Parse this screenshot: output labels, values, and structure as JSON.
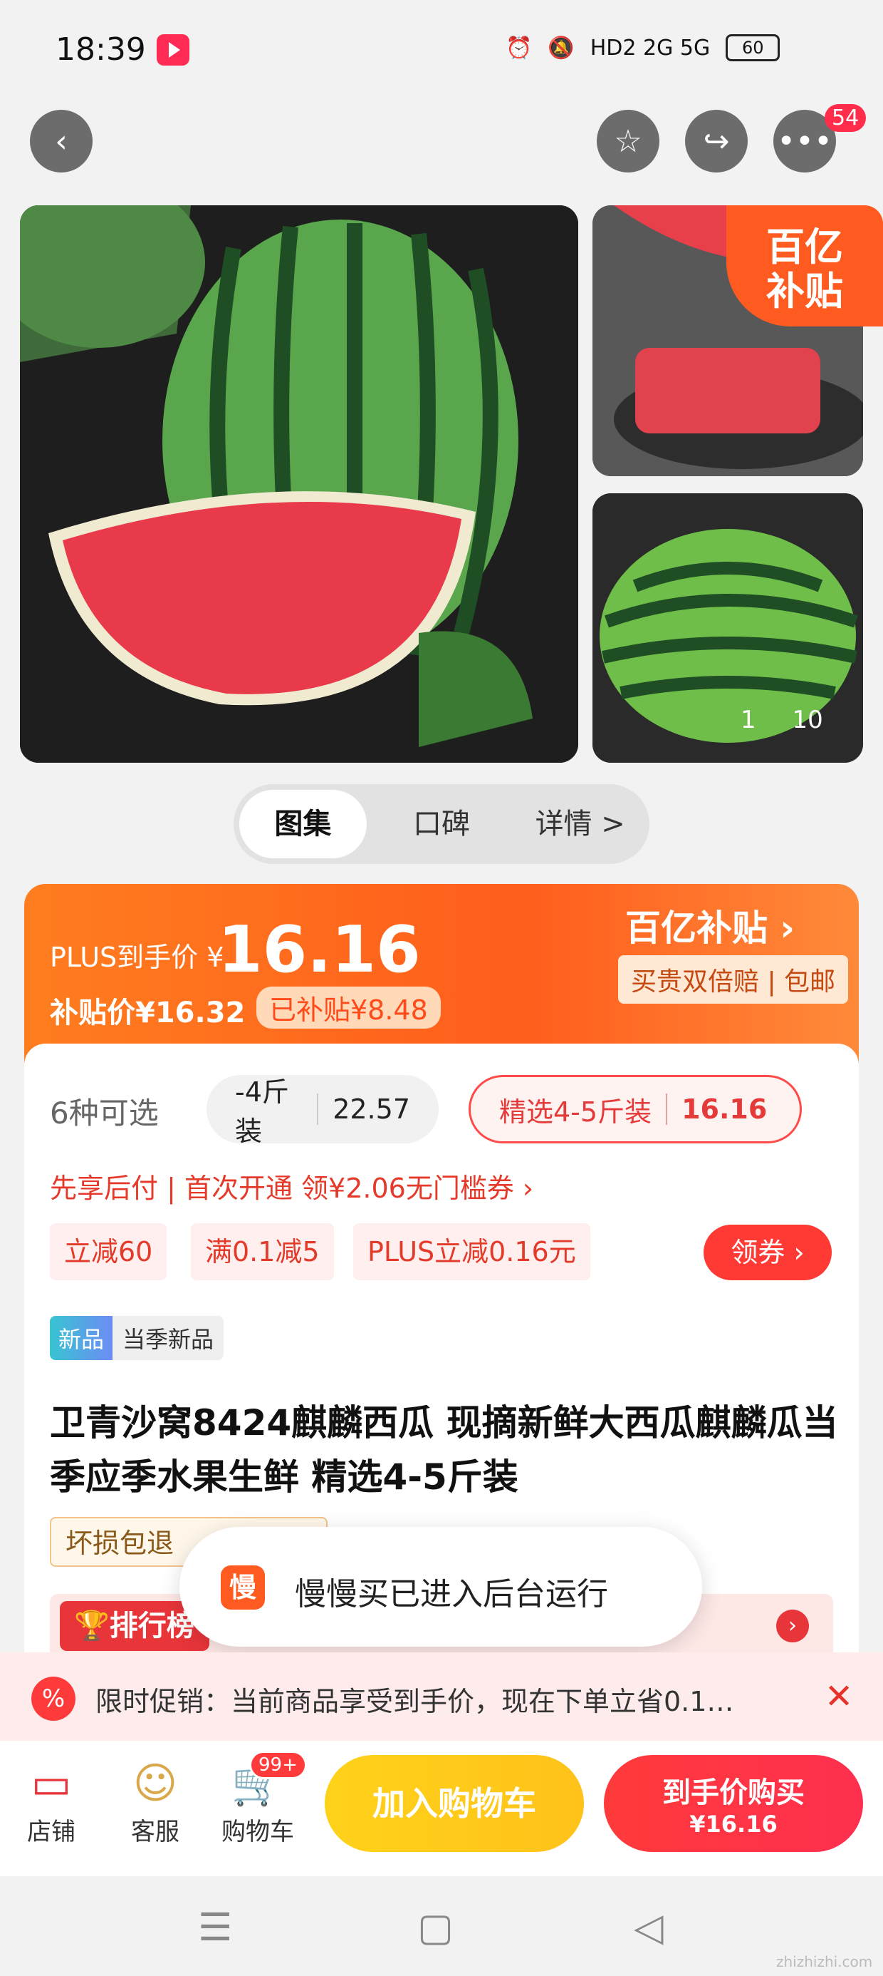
{
  "status_bar": {
    "time": "18:39",
    "network": "HD2  2G  5G",
    "battery": "60"
  },
  "top_nav": {
    "badge_count": "54"
  },
  "gallery": {
    "subsidy_corner_line1": "百亿",
    "subsidy_corner_line2": "补贴",
    "counter_current": "1",
    "counter_total": "10"
  },
  "tabs": [
    "图集",
    "口碑",
    "详情 >"
  ],
  "price": {
    "plus_label": "PLUS到手价 ¥",
    "plus_price": "16.16",
    "subsidy_label": "补贴价¥16.32",
    "subsidized": "已补贴¥8.48",
    "brand": "百亿补贴 ›",
    "guarantee": "买贵双倍赔 | 包邮"
  },
  "options": {
    "count": "6种可选",
    "opt1_name": "-4斤装",
    "opt1_price": "22.57",
    "opt2_name": "精选4-5斤装",
    "opt2_price": "16.16"
  },
  "finance": "先享后付 | 首次开通 领¥2.06无门槛券 ›",
  "chips": [
    "立减60",
    "满0.1减5",
    "PLUS立减0.16元"
  ],
  "coupon_button": "领券 ›",
  "new_tag": {
    "a": "新品",
    "b": "当季新品"
  },
  "title": "卫青沙窝8424麒麟西瓜 现摘新鲜大西瓜麒麟瓜当季应季水果生鲜 精选4-5斤装",
  "damage_tag": "坏损包退",
  "ranking_label": "🏆排行榜",
  "toast": {
    "icon": "慢",
    "text": "慢慢买已进入后台运行"
  },
  "promo": {
    "icon": "%",
    "text": "限时促销：当前商品享受到手价，现在下单立省0.1…",
    "close": "✕"
  },
  "bottom_nav": {
    "store": "店铺",
    "service": "客服",
    "cart": "购物车",
    "cart_badge": "99+",
    "add_cart": "加入购物车",
    "buy_line1": "到手价购买",
    "buy_line2": "¥16.16"
  },
  "watermark": "zhizhizhi.com",
  "colors": {
    "accent": "#ff5a1f",
    "red": "#ff3a3a",
    "yellow": "#ffc21a"
  }
}
